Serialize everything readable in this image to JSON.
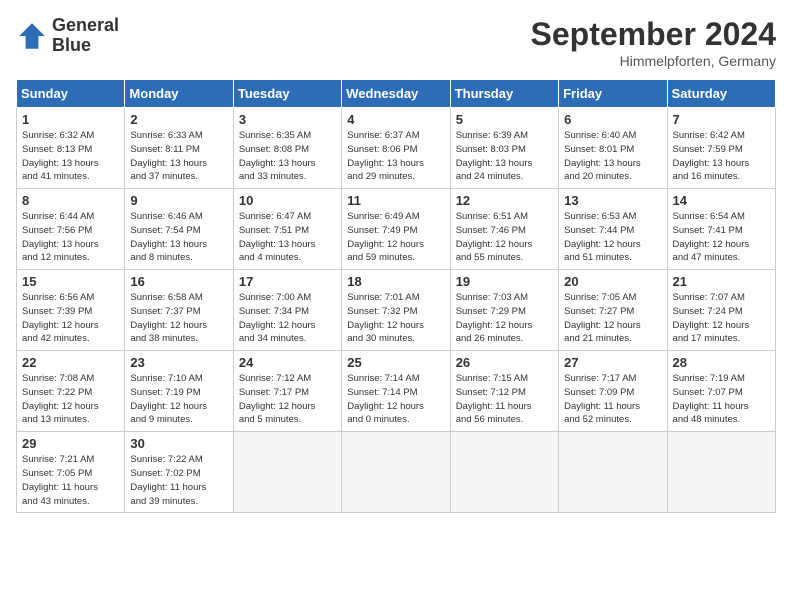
{
  "header": {
    "logo_line1": "General",
    "logo_line2": "Blue",
    "month": "September 2024",
    "location": "Himmelpforten, Germany"
  },
  "weekdays": [
    "Sunday",
    "Monday",
    "Tuesday",
    "Wednesday",
    "Thursday",
    "Friday",
    "Saturday"
  ],
  "weeks": [
    [
      {
        "day": "1",
        "lines": [
          "Sunrise: 6:32 AM",
          "Sunset: 8:13 PM",
          "Daylight: 13 hours",
          "and 41 minutes."
        ]
      },
      {
        "day": "2",
        "lines": [
          "Sunrise: 6:33 AM",
          "Sunset: 8:11 PM",
          "Daylight: 13 hours",
          "and 37 minutes."
        ]
      },
      {
        "day": "3",
        "lines": [
          "Sunrise: 6:35 AM",
          "Sunset: 8:08 PM",
          "Daylight: 13 hours",
          "and 33 minutes."
        ]
      },
      {
        "day": "4",
        "lines": [
          "Sunrise: 6:37 AM",
          "Sunset: 8:06 PM",
          "Daylight: 13 hours",
          "and 29 minutes."
        ]
      },
      {
        "day": "5",
        "lines": [
          "Sunrise: 6:39 AM",
          "Sunset: 8:03 PM",
          "Daylight: 13 hours",
          "and 24 minutes."
        ]
      },
      {
        "day": "6",
        "lines": [
          "Sunrise: 6:40 AM",
          "Sunset: 8:01 PM",
          "Daylight: 13 hours",
          "and 20 minutes."
        ]
      },
      {
        "day": "7",
        "lines": [
          "Sunrise: 6:42 AM",
          "Sunset: 7:59 PM",
          "Daylight: 13 hours",
          "and 16 minutes."
        ]
      }
    ],
    [
      {
        "day": "8",
        "lines": [
          "Sunrise: 6:44 AM",
          "Sunset: 7:56 PM",
          "Daylight: 13 hours",
          "and 12 minutes."
        ]
      },
      {
        "day": "9",
        "lines": [
          "Sunrise: 6:46 AM",
          "Sunset: 7:54 PM",
          "Daylight: 13 hours",
          "and 8 minutes."
        ]
      },
      {
        "day": "10",
        "lines": [
          "Sunrise: 6:47 AM",
          "Sunset: 7:51 PM",
          "Daylight: 13 hours",
          "and 4 minutes."
        ]
      },
      {
        "day": "11",
        "lines": [
          "Sunrise: 6:49 AM",
          "Sunset: 7:49 PM",
          "Daylight: 12 hours",
          "and 59 minutes."
        ]
      },
      {
        "day": "12",
        "lines": [
          "Sunrise: 6:51 AM",
          "Sunset: 7:46 PM",
          "Daylight: 12 hours",
          "and 55 minutes."
        ]
      },
      {
        "day": "13",
        "lines": [
          "Sunrise: 6:53 AM",
          "Sunset: 7:44 PM",
          "Daylight: 12 hours",
          "and 51 minutes."
        ]
      },
      {
        "day": "14",
        "lines": [
          "Sunrise: 6:54 AM",
          "Sunset: 7:41 PM",
          "Daylight: 12 hours",
          "and 47 minutes."
        ]
      }
    ],
    [
      {
        "day": "15",
        "lines": [
          "Sunrise: 6:56 AM",
          "Sunset: 7:39 PM",
          "Daylight: 12 hours",
          "and 42 minutes."
        ]
      },
      {
        "day": "16",
        "lines": [
          "Sunrise: 6:58 AM",
          "Sunset: 7:37 PM",
          "Daylight: 12 hours",
          "and 38 minutes."
        ]
      },
      {
        "day": "17",
        "lines": [
          "Sunrise: 7:00 AM",
          "Sunset: 7:34 PM",
          "Daylight: 12 hours",
          "and 34 minutes."
        ]
      },
      {
        "day": "18",
        "lines": [
          "Sunrise: 7:01 AM",
          "Sunset: 7:32 PM",
          "Daylight: 12 hours",
          "and 30 minutes."
        ]
      },
      {
        "day": "19",
        "lines": [
          "Sunrise: 7:03 AM",
          "Sunset: 7:29 PM",
          "Daylight: 12 hours",
          "and 26 minutes."
        ]
      },
      {
        "day": "20",
        "lines": [
          "Sunrise: 7:05 AM",
          "Sunset: 7:27 PM",
          "Daylight: 12 hours",
          "and 21 minutes."
        ]
      },
      {
        "day": "21",
        "lines": [
          "Sunrise: 7:07 AM",
          "Sunset: 7:24 PM",
          "Daylight: 12 hours",
          "and 17 minutes."
        ]
      }
    ],
    [
      {
        "day": "22",
        "lines": [
          "Sunrise: 7:08 AM",
          "Sunset: 7:22 PM",
          "Daylight: 12 hours",
          "and 13 minutes."
        ]
      },
      {
        "day": "23",
        "lines": [
          "Sunrise: 7:10 AM",
          "Sunset: 7:19 PM",
          "Daylight: 12 hours",
          "and 9 minutes."
        ]
      },
      {
        "day": "24",
        "lines": [
          "Sunrise: 7:12 AM",
          "Sunset: 7:17 PM",
          "Daylight: 12 hours",
          "and 5 minutes."
        ]
      },
      {
        "day": "25",
        "lines": [
          "Sunrise: 7:14 AM",
          "Sunset: 7:14 PM",
          "Daylight: 12 hours",
          "and 0 minutes."
        ]
      },
      {
        "day": "26",
        "lines": [
          "Sunrise: 7:15 AM",
          "Sunset: 7:12 PM",
          "Daylight: 11 hours",
          "and 56 minutes."
        ]
      },
      {
        "day": "27",
        "lines": [
          "Sunrise: 7:17 AM",
          "Sunset: 7:09 PM",
          "Daylight: 11 hours",
          "and 52 minutes."
        ]
      },
      {
        "day": "28",
        "lines": [
          "Sunrise: 7:19 AM",
          "Sunset: 7:07 PM",
          "Daylight: 11 hours",
          "and 48 minutes."
        ]
      }
    ],
    [
      {
        "day": "29",
        "lines": [
          "Sunrise: 7:21 AM",
          "Sunset: 7:05 PM",
          "Daylight: 11 hours",
          "and 43 minutes."
        ]
      },
      {
        "day": "30",
        "lines": [
          "Sunrise: 7:22 AM",
          "Sunset: 7:02 PM",
          "Daylight: 11 hours",
          "and 39 minutes."
        ]
      },
      null,
      null,
      null,
      null,
      null
    ]
  ]
}
